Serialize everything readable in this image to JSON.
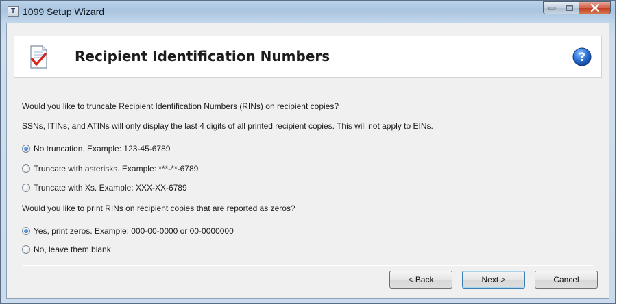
{
  "window": {
    "title": "1099 Setup Wizard",
    "app_icon_glyph": "T",
    "controls": {
      "minimize": "minimize-icon",
      "maximize": "maximize-icon",
      "close": "close-icon"
    }
  },
  "header": {
    "title": "Recipient Identification Numbers",
    "icon": "checklist-document-icon",
    "help_icon": "help-icon",
    "help_glyph": "?"
  },
  "content": {
    "question1": "Would you like to truncate Recipient Identification Numbers (RINs) on recipient copies?",
    "info1": "SSNs, ITINs, and ATINs will only display the last 4 digits of all printed recipient copies. This will not apply to EINs.",
    "truncation_options": [
      {
        "label": "No truncation. Example: 123-45-6789",
        "selected": true
      },
      {
        "label": "Truncate with asterisks. Example: ***-**-6789",
        "selected": false
      },
      {
        "label": "Truncate with Xs. Example: XXX-XX-6789",
        "selected": false
      }
    ],
    "question2": "Would you like to print RINs on recipient copies that are reported as zeros?",
    "zero_options": [
      {
        "label": "Yes, print zeros. Example: 000-00-0000 or 00-0000000",
        "selected": true
      },
      {
        "label": "No, leave them blank.",
        "selected": false
      }
    ]
  },
  "footer": {
    "back_label": "< Back",
    "next_label": "Next >",
    "cancel_label": "Cancel"
  },
  "colors": {
    "accent_blue": "#1e5fb6",
    "checkmark_red": "#d7261e",
    "help_blue": "#2a6fd6"
  }
}
